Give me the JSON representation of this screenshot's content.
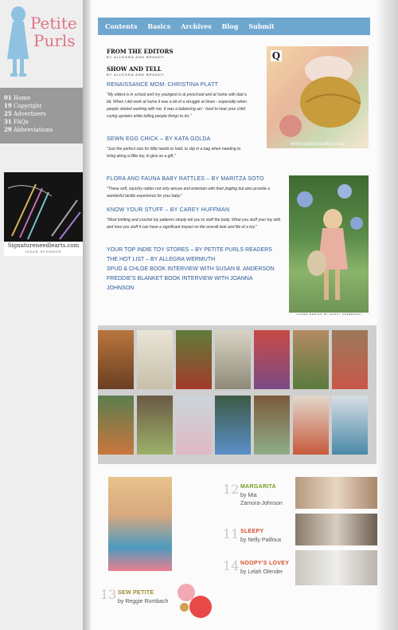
{
  "logo": {
    "line1": "Petite",
    "line2": "Purls"
  },
  "sidebar": {
    "nav": [
      {
        "num": "01",
        "label": "Home"
      },
      {
        "num": "19",
        "label": "Copyright"
      },
      {
        "num": "25",
        "label": "Advertisers"
      },
      {
        "num": "31",
        "label": "FAQs"
      },
      {
        "num": "29",
        "label": "Abbreviations"
      }
    ],
    "sponsor": {
      "url": "Signatureneedlearts.com",
      "caption": "ISSUE SPONSOR"
    }
  },
  "topnav": [
    "Contents",
    "Basics",
    "Archives",
    "Blog",
    "Submit"
  ],
  "sections": {
    "editors": {
      "title": "FROM THE EDITORS",
      "by": "BY ALLEGRA AND BRANDY"
    },
    "show": {
      "title": "SHOW AND TELL",
      "by": "BY ALLEGRA AND BRANDY"
    }
  },
  "articles": [
    {
      "title": "RENAISSANCE MOM: CHRISTINA PLATT",
      "quote": "\"My eldest is in school and my youngest is at preschool and at home with dad a bit. When I did work at home it was a bit of a struggle at times - especially when people started working with me. It was a balancing act - hard to hear your child crying upstairs while telling people things to do.\""
    },
    {
      "title": "SEWN EGG CHICK – BY KATA GOLDA",
      "quote": "\"Just the perfect size for little hands to hold, to slip in a bag when needing to bring along a little toy, to give as a gift.\""
    },
    {
      "title": "FLORA AND FAUNA BABY RATTLES – BY MARITZA SOTO",
      "quote": "\"These soft, squishy rattles not only amuse and entertain with their jingling but also provide a wonderful tactile experience for your baby\""
    },
    {
      "title": "KNOW YOUR STUFF – BY CAREY HUFFMAN",
      "quote": "\"Most knitting and crochet toy patterns simply tell you to stuff the body. What you stuff your toy with and how you stuff it can have a significant impact on the overall look and life of a toy.\""
    }
  ],
  "more_links": [
    "YOUR TOP INDIE TOY STORES – BY PETITE PURLS READERS",
    "THE HOT LIST – BY ALLEGRA WERMUTH",
    "SPUD & CHLOE BOOK INTERVIEW WITH SUSAN B. ANDERSON",
    "FREDDIE'S BLANKET BOOK INTERVIEW WITH JOANNA JOHNSON"
  ],
  "photos": {
    "q_url": "www.quinceandco.com",
    "q_letter": "Q",
    "cover_caption": "COVER DESIGN BY NANCY ANDERSON"
  },
  "colors": {
    "nav_blue": "#6fa7cf",
    "link_blue": "#2a5a9a",
    "logo_pink": "#e27486",
    "margarita": "#7a9a22",
    "sleepy": "#d7502e",
    "noopy": "#d7502e",
    "sew": "#9a8a2a"
  },
  "patterns": [
    {
      "num": "12",
      "title": "MARGARITA",
      "by": "by Mia",
      "by2": "Zamora-Johnson"
    },
    {
      "num": "11",
      "title": "SLEEPY",
      "by": "by Nelly Pailloux"
    },
    {
      "num": "14",
      "title": "NOOPY'S LOVEY",
      "by": "by Lelah Olender"
    },
    {
      "num": "13",
      "title": "SEW PETITE",
      "by": "by Reggie Rombach"
    }
  ]
}
